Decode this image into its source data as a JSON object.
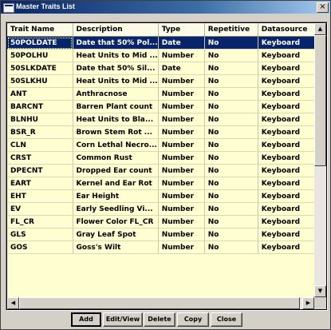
{
  "window": {
    "title": "Master Traits List",
    "close_glyph": "×"
  },
  "table": {
    "columns": [
      "Trait Name",
      "Description",
      "Type",
      "Repetitive",
      "Datasource"
    ],
    "selected_row_index": 0,
    "rows": [
      [
        "50POLDATE",
        "Date that 50% Pol...",
        "Date",
        "No",
        "Keyboard"
      ],
      [
        "50POLHU",
        "Heat Units to Mid ...",
        "Number",
        "No",
        "Keyboard"
      ],
      [
        "50SLKDATE",
        "Date that 50% Sil...",
        "Date",
        "No",
        "Keyboard"
      ],
      [
        "50SLKHU",
        "Heat Units to Mid ...",
        "Number",
        "No",
        "Keyboard"
      ],
      [
        "ANT",
        "Anthracnose",
        "Number",
        "No",
        "Keyboard"
      ],
      [
        "BARCNT",
        "Barren Plant count",
        "Number",
        "No",
        "Keyboard"
      ],
      [
        "BLNHU",
        "Heat Units to Bla...",
        "Number",
        "No",
        "Keyboard"
      ],
      [
        "BSR_R",
        "Brown Stem Rot ...",
        "Number",
        "No",
        "Keyboard"
      ],
      [
        "CLN",
        "Corn Lethal Necro...",
        "Number",
        "No",
        "Keyboard"
      ],
      [
        "CRST",
        "Common Rust",
        "Number",
        "No",
        "Keyboard"
      ],
      [
        "DPECNT",
        "Dropped Ear count",
        "Number",
        "No",
        "Keyboard"
      ],
      [
        "EART",
        "Kernel and Ear Rot",
        "Number",
        "No",
        "Keyboard"
      ],
      [
        "EHT",
        "Ear Height",
        "Number",
        "No",
        "Keyboard"
      ],
      [
        "EV",
        "Early Seedling Vi...",
        "Number",
        "No",
        "Keyboard"
      ],
      [
        "FL_CR",
        "Flower Color FL_CR",
        "Number",
        "No",
        "Keyboard"
      ],
      [
        "GLS",
        "Gray Leaf Spot",
        "Number",
        "No",
        "Keyboard"
      ],
      [
        "GOS",
        "Goss's Wilt",
        "Number",
        "No",
        "Keyboard"
      ]
    ]
  },
  "scrollbars": {
    "up_glyph": "▲",
    "down_glyph": "▼",
    "left_glyph": "◀",
    "right_glyph": "▶"
  },
  "buttons": {
    "add": "Add",
    "edit_view": "Edit/View",
    "delete": "Delete",
    "copy": "Copy",
    "close": "Close"
  },
  "colors": {
    "title_bar": "#0a246a",
    "grid_background": "#fefed0",
    "selection": "#08246b"
  }
}
